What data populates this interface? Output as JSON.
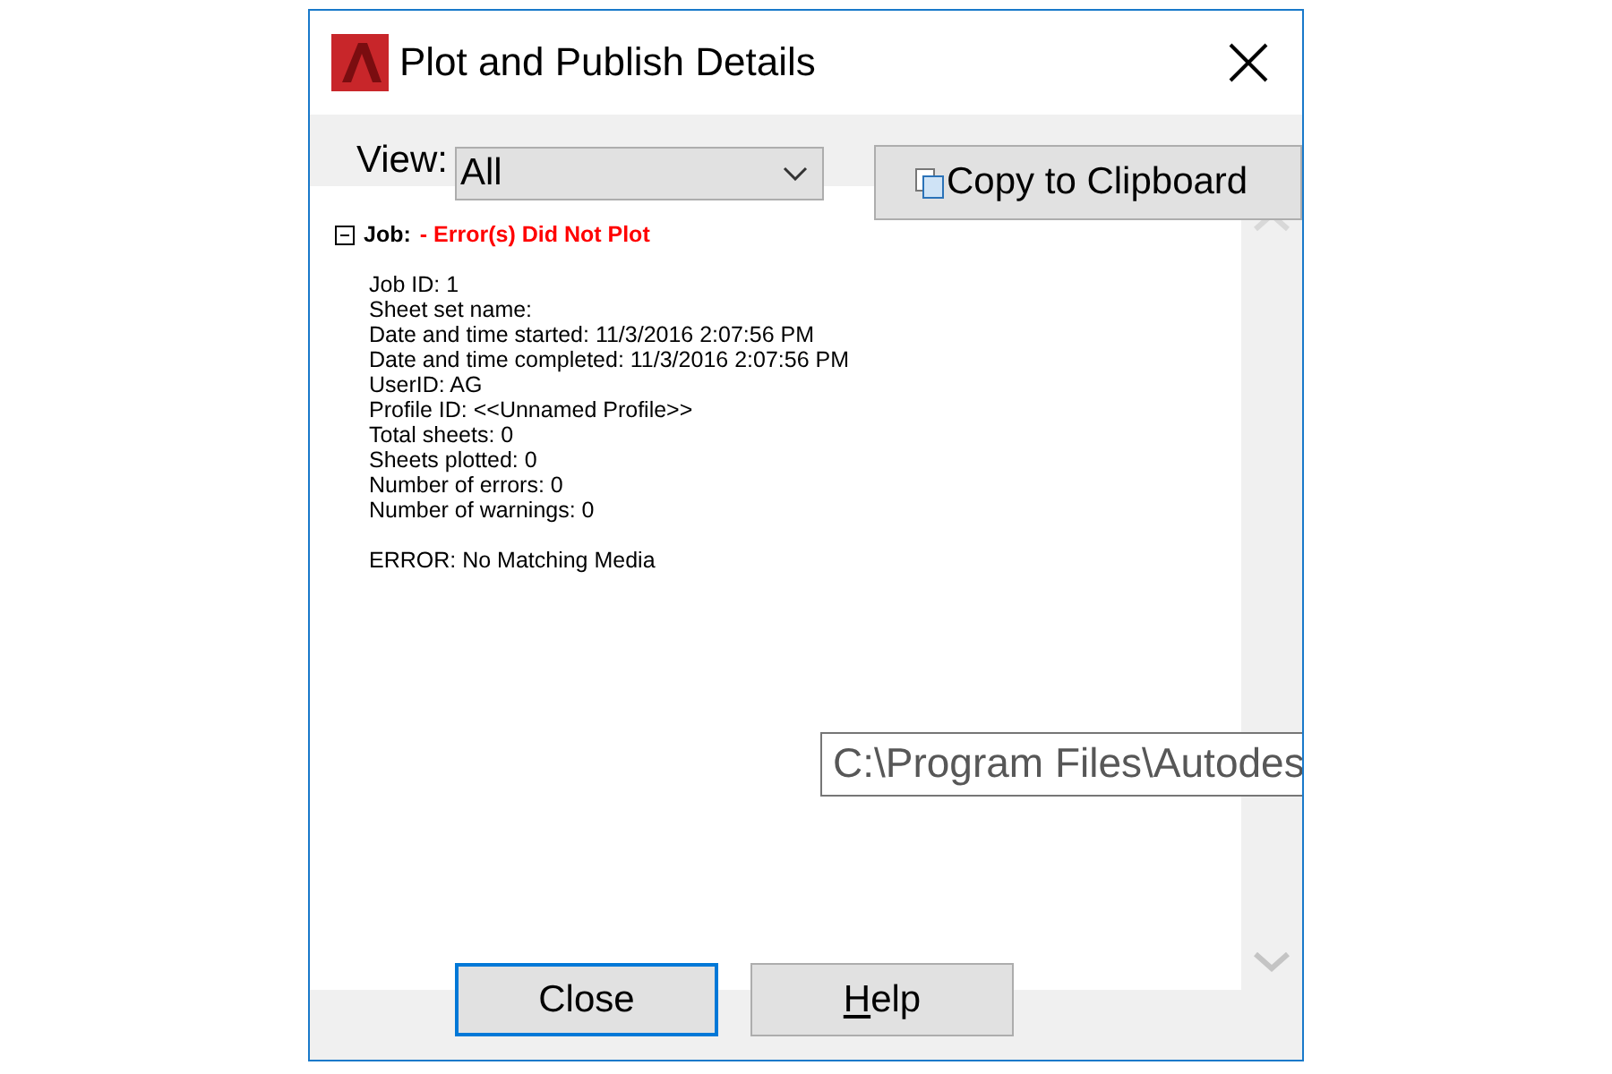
{
  "window": {
    "title": "Plot and Publish Details"
  },
  "view": {
    "label": "View:",
    "value": "All"
  },
  "copy_button": {
    "label": "Copy to Clipboard"
  },
  "job": {
    "label": "Job:",
    "status": "- Error(s) Did Not Plot",
    "expanded": true,
    "lines": [
      "Job ID: 1",
      "Sheet set name:",
      "Date and time started: 11/3/2016 2:07:56 PM",
      "Date and time completed: 11/3/2016 2:07:56 PM",
      "UserID: AG",
      "Profile ID: <<Unnamed Profile>>",
      "Total sheets: 0",
      "Sheets plotted: 0",
      "Number of errors: 0",
      "Number of warnings: 0"
    ],
    "error": "ERROR: No Matching Media"
  },
  "tooltip": {
    "text": "C:\\Program Files\\Autodes"
  },
  "buttons": [
    {
      "label": "Close",
      "default": true
    },
    {
      "label": "Help",
      "default": false
    }
  ]
}
